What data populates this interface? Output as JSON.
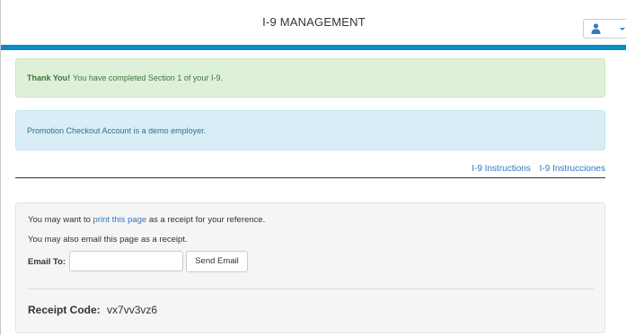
{
  "header": {
    "title": "I-9 MANAGEMENT",
    "user_icon": "user-icon",
    "caret_icon": "caret-down-icon"
  },
  "alerts": {
    "success": {
      "strong": "Thank You!",
      "text": "You have completed Section 1 of your I-9."
    },
    "info": {
      "text": "Promotion Checkout Account is a demo employer."
    }
  },
  "links": {
    "instructions": "I-9 Instructions",
    "instrucciones": "I-9 Instrucciones"
  },
  "receipt_panel": {
    "line1_prefix": "You may want to",
    "print_link": "print this page",
    "line1_suffix": "as a receipt for your reference.",
    "line2": "You may also email this page as a receipt.",
    "email_label": "Email To:",
    "email_value": "",
    "send_button": "Send Email",
    "receipt_label": "Receipt Code:",
    "receipt_code": "vx7vv3vz6"
  },
  "colors": {
    "brand_bar": "#0b8ac9",
    "success_bg": "#dff0d8",
    "info_bg": "#d9edf7",
    "link": "#2f7bbf"
  }
}
